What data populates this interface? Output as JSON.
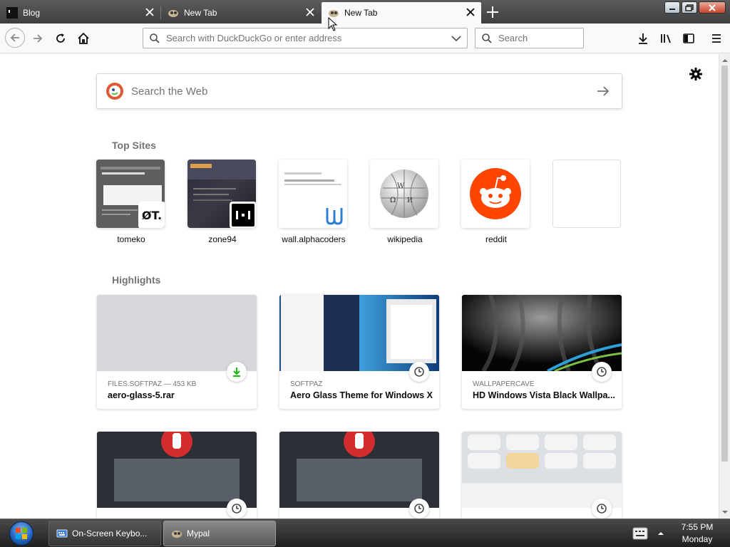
{
  "tabs": [
    {
      "title": "Blog"
    },
    {
      "title": "New Tab"
    },
    {
      "title": "New Tab"
    }
  ],
  "toolbar": {
    "url_placeholder": "Search with DuckDuckGo or enter address",
    "search_placeholder": "Search"
  },
  "newtab": {
    "search_placeholder": "Search the Web",
    "top_sites_heading": "Top Sites",
    "highlights_heading": "Highlights",
    "top_sites": [
      {
        "label": "tomeko",
        "badge": "ØT."
      },
      {
        "label": "zone94"
      },
      {
        "label": "wall.alphacoders"
      },
      {
        "label": "wikipedia"
      },
      {
        "label": "reddit"
      }
    ],
    "highlights": [
      {
        "source": "FILES.SOFTPAZ — 453 KB",
        "title": "aero-glass-5.rar",
        "icon": "download-icon"
      },
      {
        "source": "SOFTPAZ",
        "title": "Aero Glass Theme for Windows XP",
        "icon": "clock-icon"
      },
      {
        "source": "WALLPAPERCAVE",
        "title": "HD Windows Vista Black Wallpa...",
        "icon": "clock-icon"
      },
      {
        "source": "",
        "title": "",
        "icon": "clock-icon"
      },
      {
        "source": "",
        "title": "",
        "icon": "clock-icon"
      },
      {
        "source": "",
        "title": "",
        "icon": "clock-icon"
      }
    ]
  },
  "taskbar": {
    "items": [
      {
        "label": "On-Screen Keybo..."
      },
      {
        "label": "Mypal"
      }
    ],
    "clock_time": "7:55 PM",
    "clock_day": "Monday"
  },
  "colors": {
    "accent": "#0060df",
    "reddit": "#ff4500",
    "duckduckgo": "#de5833",
    "download_green": "#12bc00"
  }
}
